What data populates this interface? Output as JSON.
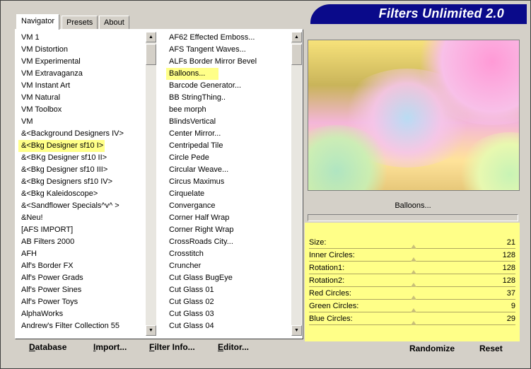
{
  "window": {
    "title": "Filters Unlimited 2.0"
  },
  "tabs": [
    {
      "label": "Navigator",
      "active": true
    },
    {
      "label": "Presets",
      "active": false
    },
    {
      "label": "About",
      "active": false
    }
  ],
  "categories": {
    "items": [
      "VM 1",
      "VM Distortion",
      "VM Experimental",
      "VM Extravaganza",
      "VM Instant Art",
      "VM Natural",
      "VM Toolbox",
      "VM",
      "&<Background Designers IV>",
      "&<Bkg Designer sf10 I>",
      "&<BKg Designer sf10 II>",
      "&<Bkg Designer sf10 III>",
      "&<Bkg Designers sf10 IV>",
      "&<Bkg Kaleidoscope>",
      "&<Sandflower Specials^v^ >",
      "&Neu!",
      "[AFS IMPORT]",
      "AB Filters 2000",
      "AFH",
      "Alf's Border FX",
      "Alf's Power Grads",
      "Alf's Power Sines",
      "Alf's Power Toys",
      "AlphaWorks",
      "Andrew's Filter Collection 55"
    ],
    "selected_index": 9
  },
  "filters": {
    "items": [
      "AF62 Effected Emboss...",
      "AFS Tangent Waves...",
      "ALFs Border Mirror Bevel",
      "Balloons...",
      "Barcode Generator...",
      "BB StringThing..",
      "bee morph",
      "BlindsVertical",
      "Center Mirror...",
      "Centripedal Tile",
      "Circle Pede",
      "Circular Weave...",
      "Circus Maximus",
      "Cirquelate",
      "Convergance",
      "Corner Half Wrap",
      "Corner Right Wrap",
      "CrossRoads City...",
      "Crosstitch",
      "Cruncher",
      "Cut Glass  BugEye",
      "Cut Glass 01",
      "Cut Glass 02",
      "Cut Glass 03",
      "Cut Glass 04"
    ],
    "selected_index": 3
  },
  "preview": {
    "filter_name": "Balloons..."
  },
  "params": [
    {
      "label": "Size:",
      "value": "21"
    },
    {
      "label": "Inner Circles:",
      "value": "128"
    },
    {
      "label": "Rotation1:",
      "value": "128"
    },
    {
      "label": "Rotation2:",
      "value": "128"
    },
    {
      "label": "Red Circles:",
      "value": "37"
    },
    {
      "label": "Green Circles:",
      "value": "9"
    },
    {
      "label": "Blue Circles:",
      "value": "29"
    }
  ],
  "buttons": {
    "database": {
      "mnemonic": "D",
      "rest": "atabase"
    },
    "import": {
      "mnemonic": "I",
      "rest": "mport..."
    },
    "filter_info": {
      "mnemonic": "F",
      "rest": "ilter Info..."
    },
    "editor": {
      "mnemonic": "E",
      "rest": "ditor..."
    },
    "randomize": "Randomize",
    "reset": "Reset"
  },
  "colors": {
    "highlight": "#ffff88",
    "banner": "#0a0a8a"
  }
}
